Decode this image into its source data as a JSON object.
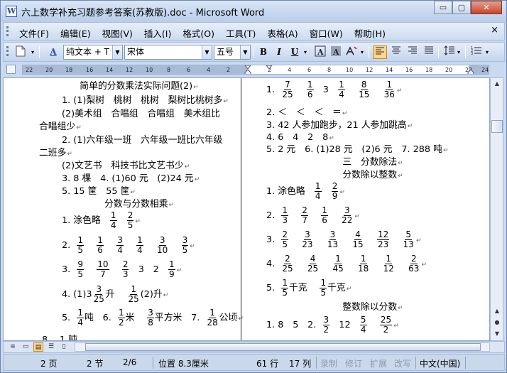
{
  "title": "六上数学补充习题参考答案(苏教版).doc - Microsoft Word",
  "window_buttons": {
    "minimize": "▭",
    "maximize": "▢",
    "close": "✕"
  },
  "menu": [
    "文件(F)",
    "编辑(E)",
    "视图(V)",
    "插入(I)",
    "格式(O)",
    "工具(T)",
    "表格(A)",
    "窗口(W)",
    "帮助(H)"
  ],
  "menu_close": "×",
  "toolbar": {
    "style_icon": "A",
    "style": "纯文本 + T",
    "font": "宋体",
    "size": "五号",
    "bold": "B",
    "italic": "I",
    "underline": "U"
  },
  "ruler_ticks": [
    "22",
    "20",
    "18",
    "16",
    "14",
    "12",
    "10",
    "8",
    "6",
    "4",
    "2",
    "2",
    "4",
    "6",
    "8",
    "10",
    "12",
    "14",
    "16",
    "18",
    "20",
    "22",
    "24"
  ],
  "left_column": [
    {
      "text": "简单的分数乘法实际问题(2)",
      "center": true
    },
    {
      "text": "1. (1)梨树　桃树　桃树　梨树比桃树多"
    },
    {
      "text": "(2)美术组　合唱组　合唱组　美术组比"
    },
    {
      "text": "合唱组少"
    },
    {
      "text": "2. (1)六年级一班　六年级一班比六年级"
    },
    {
      "text": "二班多"
    },
    {
      "text": "(2)文艺书　科技书比文艺书少"
    },
    {
      "text": "3. 8 棵　4. (1)60 元　(2)24 元"
    },
    {
      "text": "5. 15 筐　55 筐"
    },
    {
      "text": "分数与分数相乘",
      "center": true
    }
  ],
  "left_fraction_rows": [
    {
      "prefix": "1.  涂色略",
      "fracs": [
        [
          "1",
          "4"
        ],
        [
          "2",
          "5"
        ]
      ]
    },
    {
      "prefix": "2.",
      "fracs": [
        [
          "1",
          "5"
        ],
        [
          "1",
          "6"
        ],
        [
          "3",
          "4"
        ],
        [
          "1",
          "4"
        ],
        [
          "3",
          "10"
        ],
        [
          "3",
          "5"
        ]
      ]
    },
    {
      "prefix": "3.",
      "fracs": [
        [
          "9",
          "5"
        ],
        [
          "10",
          "7"
        ],
        [
          "2",
          "3"
        ]
      ],
      "tail": "3　2",
      "fracs2": [
        [
          "1",
          "9"
        ]
      ]
    },
    {
      "prefix": "4. (1)",
      "mixed": "3",
      "fracs": [
        [
          "3",
          "25"
        ]
      ],
      "mid": "升　",
      "fracs2": [
        [
          "1",
          "25"
        ]
      ],
      "tail": "(2)升"
    },
    {
      "prefix": "5.",
      "fracs": [
        [
          "1",
          "4"
        ]
      ],
      "mid": "吨　6.",
      "fracs2": [
        [
          "1",
          "2"
        ]
      ],
      "tail": "米　",
      "fracs3": [
        [
          "3",
          "8"
        ]
      ],
      "tail2": "平方米　7.",
      "fracs4": [
        [
          "1",
          "28"
        ]
      ],
      "tail3": "公顷"
    }
  ],
  "right_column": [
    {
      "text": "2. ＜　＜　＜　＝"
    },
    {
      "text": "3. 42 人参加跑步，21 人参加跳高"
    },
    {
      "text": "4. 6　4　2　8"
    },
    {
      "text": "5. 2 元　6. (1)28 元　(2)6 元　7. 288 吨"
    },
    {
      "text": "三　分数除法",
      "center": true
    },
    {
      "text": "分数除以整数",
      "center": true
    }
  ],
  "right_fraction_rows": [
    {
      "prefix": "1.",
      "fracs": [
        [
          "7",
          "25"
        ],
        [
          "1",
          "6"
        ]
      ],
      "tail": "3",
      "fracs2": [
        [
          "1",
          "4"
        ],
        [
          "8",
          "15"
        ],
        [
          "1",
          "36"
        ]
      ]
    },
    {
      "prefix": "1.  涂色略",
      "fracs": [
        [
          "1",
          "4"
        ],
        [
          "2",
          "9"
        ]
      ]
    },
    {
      "prefix": "2.",
      "fracs": [
        [
          "1",
          "3"
        ],
        [
          "2",
          "7"
        ],
        [
          "1",
          "6"
        ],
        [
          "3",
          "22"
        ]
      ]
    },
    {
      "prefix": "3.",
      "fracs": [
        [
          "2",
          "5"
        ],
        [
          "3",
          "23"
        ],
        [
          "3",
          "13"
        ],
        [
          "4",
          "15"
        ],
        [
          "12",
          "23"
        ],
        [
          "5",
          "13"
        ]
      ]
    },
    {
      "prefix": "4.",
      "fracs": [
        [
          "2",
          "25"
        ],
        [
          "4",
          "25"
        ],
        [
          "1",
          "45"
        ],
        [
          "1",
          "18"
        ],
        [
          "1",
          "12"
        ],
        [
          "2",
          "63"
        ]
      ]
    },
    {
      "prefix": "5.",
      "fracs": [
        [
          "1",
          "5"
        ]
      ],
      "mid": "千克　",
      "fracs2": [
        [
          "1",
          "5"
        ]
      ],
      "tail": "千克"
    },
    {
      "prefix": "1. 8　5　2.",
      "fracs": [
        [
          "3",
          "2"
        ]
      ],
      "mid": "12",
      "fracs2": [
        [
          "5",
          "4"
        ],
        [
          "25",
          "2"
        ]
      ]
    }
  ],
  "right_heading_last": "整数除以分数",
  "left_bottom_partial": "8.　1 吨",
  "status": {
    "page": "2 页",
    "section": "2 节",
    "pages": "2/6",
    "position": "位置 8.3厘米",
    "line": "61 行",
    "col": "17 列",
    "rec": "录制",
    "trk": "修订",
    "ext": "扩展",
    "ovr": "改写",
    "lang": "中文(中国)"
  }
}
